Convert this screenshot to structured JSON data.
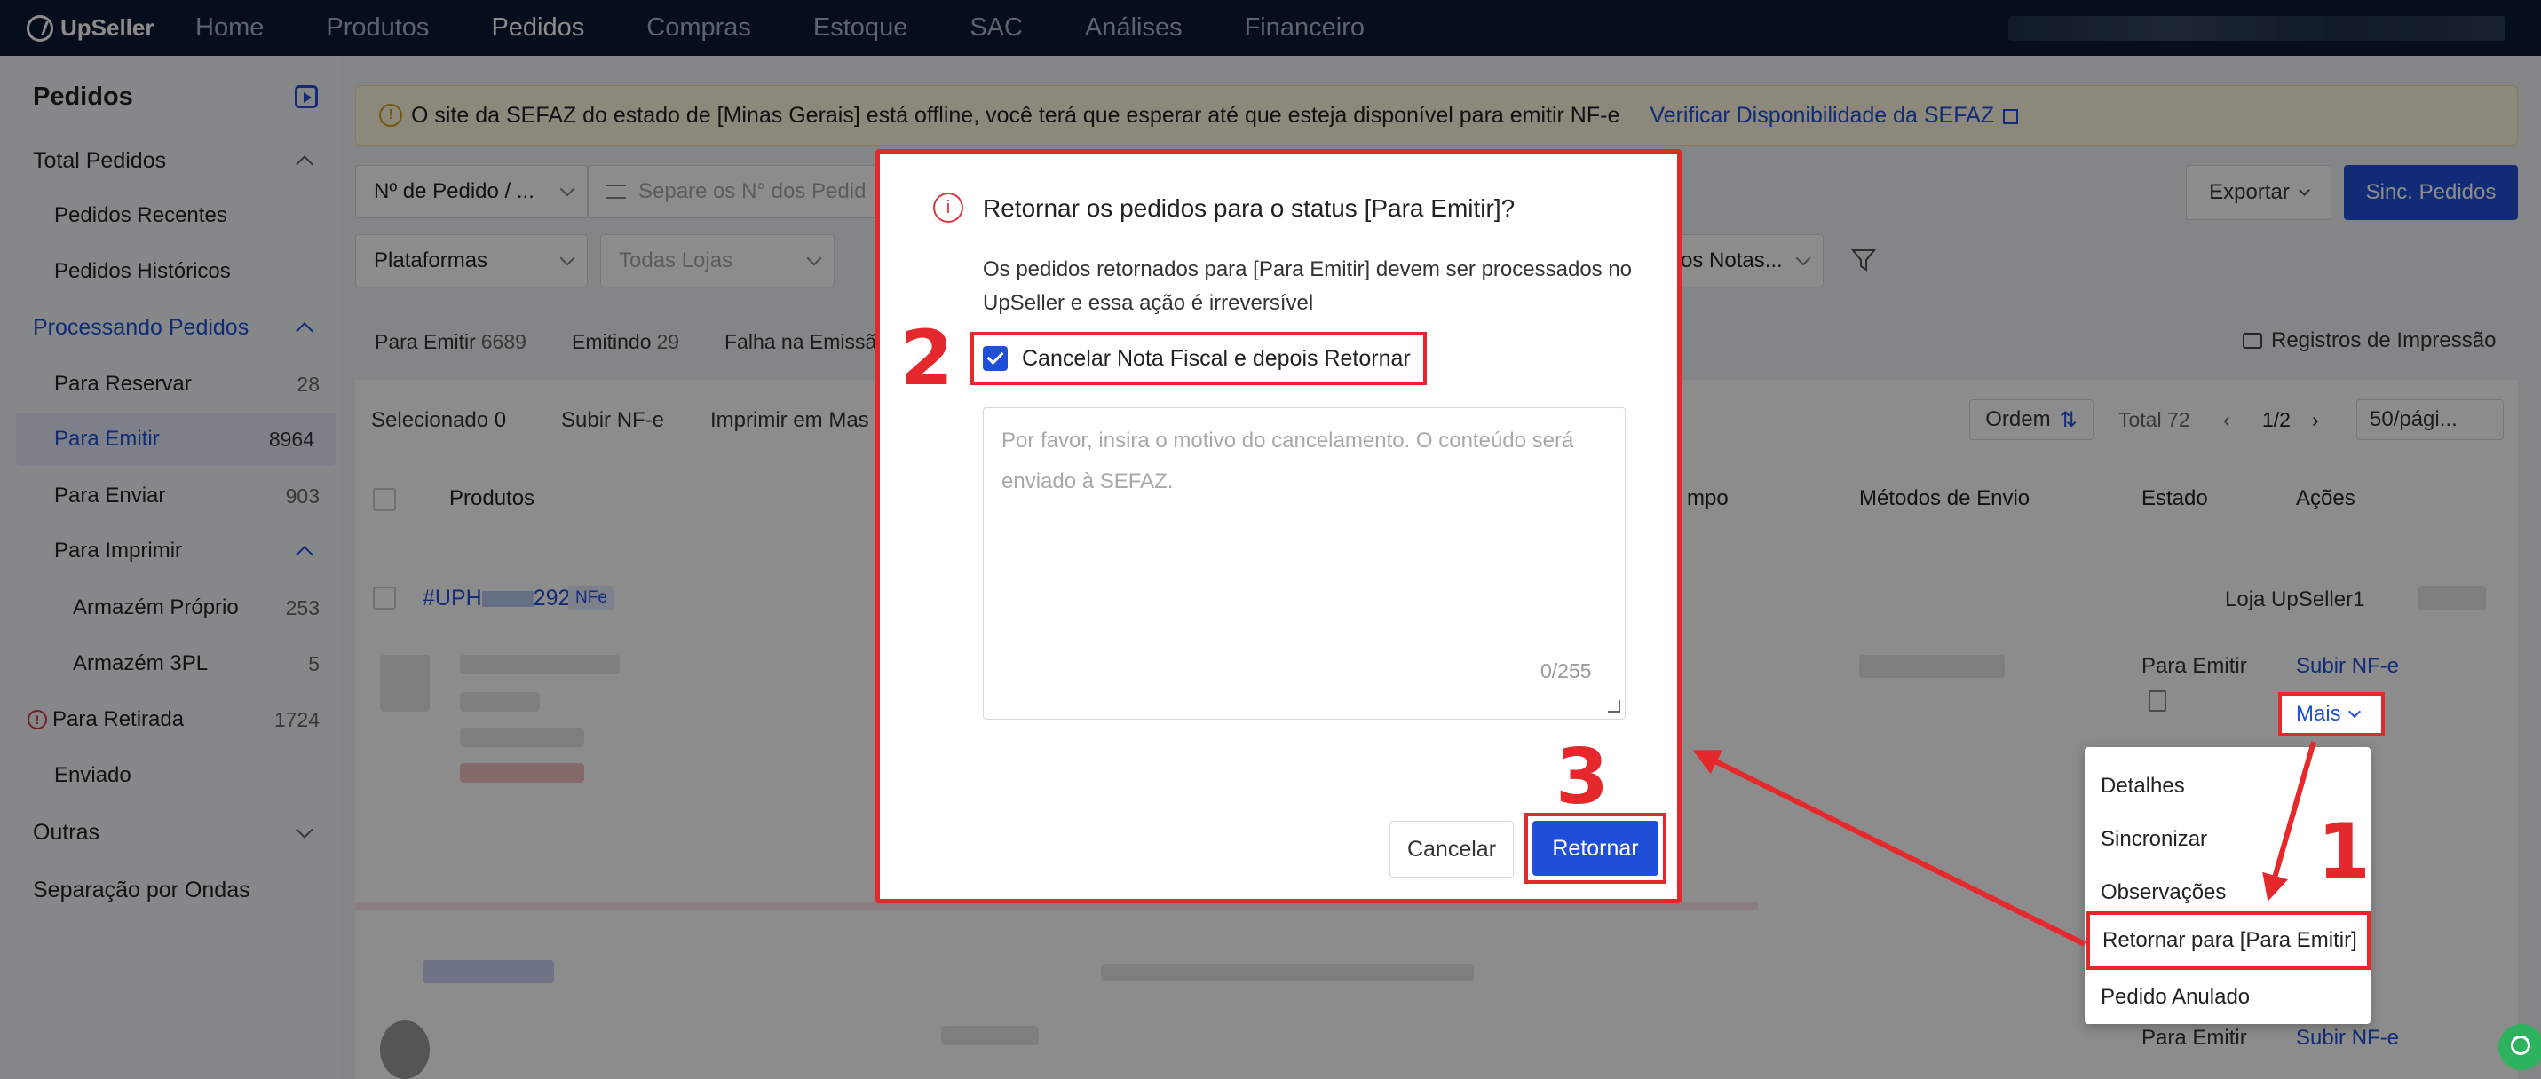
{
  "app": {
    "brand": "UpSeller"
  },
  "nav": {
    "items": [
      "Home",
      "Produtos",
      "Pedidos",
      "Compras",
      "Estoque",
      "SAC",
      "Análises",
      "Financeiro"
    ],
    "active": "Pedidos"
  },
  "sidebar": {
    "title": "Pedidos",
    "total": "Total Pedidos",
    "recent": "Pedidos Recentes",
    "history": "Pedidos Históricos",
    "processing": "Processando Pedidos",
    "reserve": {
      "label": "Para Reservar",
      "count": "28"
    },
    "emit": {
      "label": "Para Emitir",
      "count": "8964"
    },
    "send": {
      "label": "Para Enviar",
      "count": "903"
    },
    "print": "Para Imprimir",
    "own_wh": {
      "label": "Armazém Próprio",
      "count": "253"
    },
    "wh3pl": {
      "label": "Armazém 3PL",
      "count": "5"
    },
    "pickup": {
      "label": "Para Retirada",
      "count": "1724"
    },
    "sent": "Enviado",
    "others": "Outras",
    "waves": "Separação por Ondas"
  },
  "banner": {
    "text": "O site da SEFAZ do estado de [Minas Gerais] está offline, você terá que esperar até que esteja disponível para emitir NF-e",
    "link": "Verificar Disponibilidade da SEFAZ"
  },
  "filters": {
    "order_no": "Nº de Pedido / ...",
    "order_placeholder": "Separe os N° dos Pedid",
    "platforms": "Plataformas",
    "stores": "Todas Lojas",
    "notes_partial": "os Notas...",
    "export": "Exportar",
    "sync": "Sinc. Pedidos"
  },
  "status_tabs": {
    "emit": "Para Emitir",
    "emit_n": "6689",
    "emitting": "Emitindo",
    "emitting_n": "29",
    "fail": "Falha na Emissã"
  },
  "print_registry": "Registros de Impressão",
  "toolbar": {
    "selected": "Selecionado",
    "selected_n": "0",
    "upload": "Subir NF-e",
    "print_bulk": "Imprimir em Mas",
    "order": "Ordem",
    "total": "Total 72",
    "page": "1/2",
    "per_page": "50/pági..."
  },
  "table": {
    "headers": {
      "products": "Produtos",
      "time": "mpo",
      "shipping": "Métodos de Envio",
      "state": "Estado",
      "actions": "Ações"
    },
    "row1": {
      "id": "#UPH",
      "id_end": "292",
      "tag": "NFe",
      "store": "Loja UpSeller1",
      "state": "Para Emitir",
      "action": "Subir NF-e"
    },
    "row2": {
      "state": "Para Emitir",
      "action": "Subir NF-e"
    }
  },
  "dropdown": {
    "mais": "Mais",
    "items": [
      "Detalhes",
      "Sincronizar",
      "Observações",
      "Retornar para [Para Emitir]",
      "Pedido Anulado"
    ]
  },
  "modal": {
    "title": "Retornar os pedidos para o status [Para Emitir]?",
    "desc": "Os pedidos retornados para [Para Emitir] devem ser processados no UpSeller e essa ação é irreversível",
    "checkbox_label": "Cancelar Nota Fiscal e depois Retornar",
    "placeholder": "Por favor, insira o motivo do cancelamento. O conteúdo será enviado à SEFAZ.",
    "count": "0/255",
    "cancel": "Cancelar",
    "confirm": "Retornar"
  },
  "steps": {
    "s1": "1",
    "s2": "2",
    "s3": "3"
  },
  "colors": {
    "brand_blue": "#1f4fd8",
    "annotation_red": "#e4282b",
    "nav_bg": "#0b1a33"
  }
}
